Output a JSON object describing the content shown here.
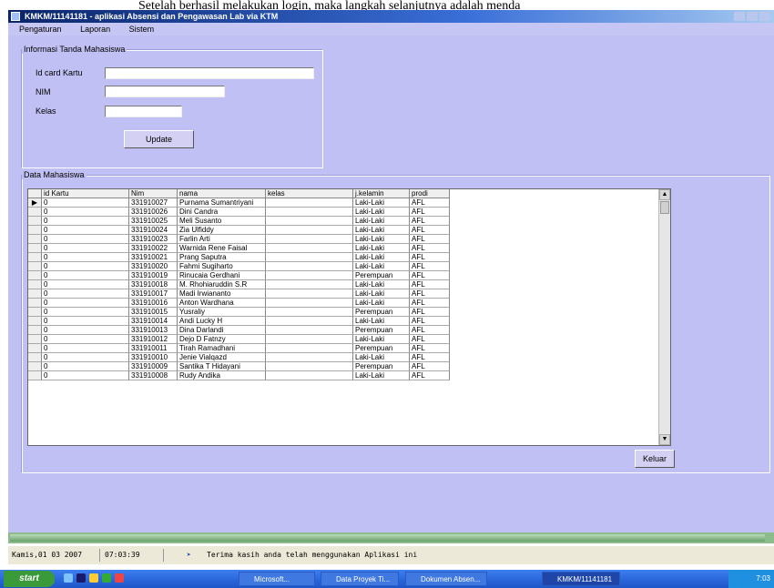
{
  "doc_text": "Setelah berhasil melakukan login, maka langkah selanjutnya adalah menda",
  "window": {
    "title": "KMKM/11141181 - aplikasi Absensi dan Pengawasan Lab via KTM"
  },
  "menu": [
    "Pengaturan",
    "Laporan",
    "Sistem"
  ],
  "form": {
    "group_title": "Informasi Tanda Mahasiswa",
    "fields": [
      {
        "label": "Id card Kartu",
        "value": ""
      },
      {
        "label": "NIM",
        "value": ""
      },
      {
        "label": "Kelas",
        "value": ""
      }
    ],
    "update_label": "Update"
  },
  "grid": {
    "group_title": "Data Mahasiswa",
    "columns": [
      "id Kartu",
      "Nim",
      "nama",
      "kelas",
      "j.kelamin",
      "prodi"
    ],
    "rows": [
      [
        "0",
        "331910027",
        "Purnama Sumantriyani",
        "",
        "Laki-Laki",
        "AFL"
      ],
      [
        "0",
        "331910026",
        "Dini Candra",
        "",
        "Laki-Laki",
        "AFL"
      ],
      [
        "0",
        "331910025",
        "Meli Susanto",
        "",
        "Laki-Laki",
        "AFL"
      ],
      [
        "0",
        "331910024",
        "Zia Ulfiddy",
        "",
        "Laki-Laki",
        "AFL"
      ],
      [
        "0",
        "331910023",
        "Farlin Arti",
        "",
        "Laki-Laki",
        "AFL"
      ],
      [
        "0",
        "331910022",
        "Warnida Rene Faisal",
        "",
        "Laki-Laki",
        "AFL"
      ],
      [
        "0",
        "331910021",
        "Prang Saputra",
        "",
        "Laki-Laki",
        "AFL"
      ],
      [
        "0",
        "331910020",
        "Fahmi Sugiharto",
        "",
        "Laki-Laki",
        "AFL"
      ],
      [
        "0",
        "331910019",
        "Rinucaia Gerdhani",
        "",
        "Perempuan",
        "AFL"
      ],
      [
        "0",
        "331910018",
        "M. Rhohiaruddin S.R",
        "",
        "Laki-Laki",
        "AFL"
      ],
      [
        "0",
        "331910017",
        "Madi Irwiananto",
        "",
        "Laki-Laki",
        "AFL"
      ],
      [
        "0",
        "331910016",
        "Anton Wardhana",
        "",
        "Laki-Laki",
        "AFL"
      ],
      [
        "0",
        "331910015",
        "Yusraliy",
        "",
        "Perempuan",
        "AFL"
      ],
      [
        "0",
        "331910014",
        "Andi Lucky H",
        "",
        "Laki-Laki",
        "AFL"
      ],
      [
        "0",
        "331910013",
        "Dina Darlandi",
        "",
        "Perempuan",
        "AFL"
      ],
      [
        "0",
        "331910012",
        "Dejo D Fatnzy",
        "",
        "Laki-Laki",
        "AFL"
      ],
      [
        "0",
        "331910011",
        "Tirah Ramadhani",
        "",
        "Perempuan",
        "AFL"
      ],
      [
        "0",
        "331910010",
        "Jenie Vialqazd",
        "",
        "Laki-Laki",
        "AFL"
      ],
      [
        "0",
        "331910009",
        "Santika T Hidayani",
        "",
        "Perempuan",
        "AFL"
      ],
      [
        "0",
        "331910008",
        "Rudy Andika",
        "",
        "Laki-Laki",
        "AFL"
      ]
    ]
  },
  "keluar_label": "Keluar",
  "progress": {
    "percent": 99
  },
  "status": {
    "date": "Kamis,01 03 2007",
    "time": "07:03:39",
    "message": "Terima kasih anda telah menggunakan Aplikasi ini"
  },
  "taskbar": {
    "start_label": "start",
    "tasks": [
      "Microsoft...",
      "Data Proyek Ti...",
      "Dokumen Absen...",
      "KMKM/11141181"
    ],
    "tray_time": "7:03"
  },
  "colors": {
    "client_bg": "#c0c0f4",
    "titlebar": "#0a246a",
    "taskbar": "#245edb",
    "progress": "#8cbc8c"
  }
}
